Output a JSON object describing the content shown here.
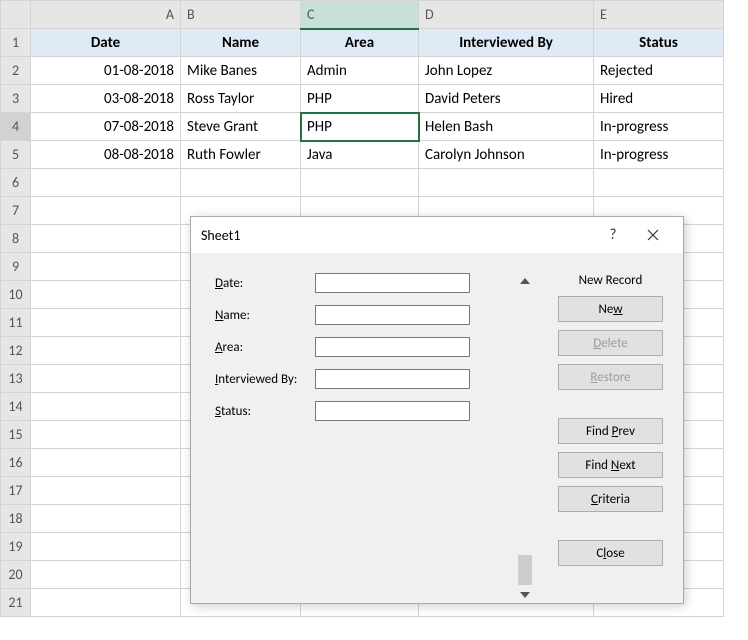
{
  "columns": [
    "A",
    "B",
    "C",
    "D",
    "E"
  ],
  "headers": {
    "A": "Date",
    "B": "Name",
    "C": "Area",
    "D": "Interviewed By",
    "E": "Status"
  },
  "rows": [
    {
      "A": "01-08-2018",
      "B": "Mike Banes",
      "C": "Admin",
      "D": "John Lopez",
      "E": "Rejected"
    },
    {
      "A": "03-08-2018",
      "B": "Ross Taylor",
      "C": "PHP",
      "D": "David Peters",
      "E": "Hired"
    },
    {
      "A": "07-08-2018",
      "B": "Steve Grant",
      "C": "PHP",
      "D": "Helen Bash",
      "E": "In-progress"
    },
    {
      "A": "08-08-2018",
      "B": "Ruth Fowler",
      "C": "Java",
      "D": "Carolyn Johnson",
      "E": "In-progress"
    }
  ],
  "selected_cell": "C4",
  "dialog": {
    "title": "Sheet1",
    "record_status": "New Record",
    "labels": {
      "date_pre": "D",
      "date_post": "ate:",
      "name_pre": "N",
      "name_post": "ame:",
      "area_pre": "A",
      "area_post": "rea:",
      "intby_pre": "I",
      "intby_post": "nterviewed By:",
      "status_pre": "S",
      "status_post": "tatus:"
    },
    "values": {
      "date": "",
      "name": "",
      "area": "",
      "intby": "",
      "status": ""
    },
    "buttons": {
      "new_pre": "Ne",
      "new_u": "w",
      "new_post": "",
      "delete_pre": "",
      "delete_u": "D",
      "delete_post": "elete",
      "restore_pre": "",
      "restore_u": "R",
      "restore_post": "estore",
      "findprev_pre": "Find ",
      "findprev_u": "P",
      "findprev_post": "rev",
      "findnext_pre": "Find ",
      "findnext_u": "N",
      "findnext_post": "ext",
      "criteria_pre": "",
      "criteria_u": "C",
      "criteria_post": "riteria",
      "close_pre": "C",
      "close_u": "l",
      "close_post": "ose"
    }
  }
}
